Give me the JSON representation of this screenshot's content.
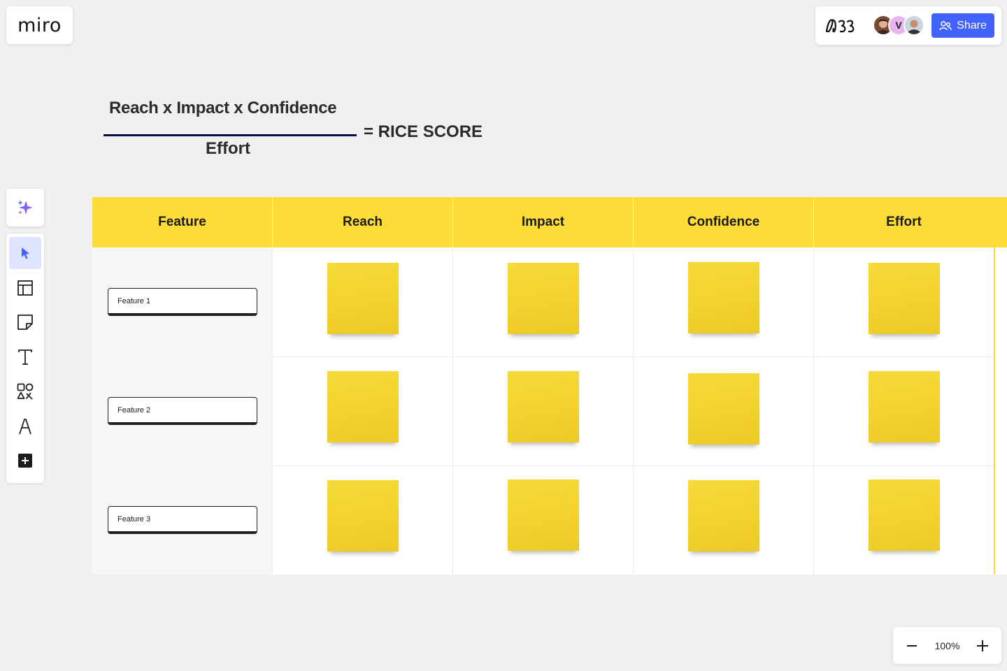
{
  "app": {
    "logo": "miro"
  },
  "header": {
    "share_label": "Share",
    "avatar_initial": "V",
    "sign_icon": "scribble-signature-icon"
  },
  "formula": {
    "numerator": "Reach x Impact x Confidence",
    "denominator": "Effort",
    "result": "= RICE SCORE"
  },
  "toolbar": {
    "items": [
      "ai-sparkle",
      "select",
      "templates",
      "sticky-note",
      "text",
      "shapes",
      "pen",
      "add"
    ]
  },
  "table": {
    "columns": [
      "Feature",
      "Reach",
      "Impact",
      "Confidence",
      "Effort"
    ],
    "rows": [
      {
        "feature": "Feature 1"
      },
      {
        "feature": "Feature 2"
      },
      {
        "feature": "Feature 3"
      }
    ],
    "header_color": "#fddc37",
    "sticky_color": "#f2d12c"
  },
  "zoom": {
    "level": "100%"
  },
  "colors": {
    "accent": "#4262ff",
    "formula_line": "#0d0b4a"
  }
}
